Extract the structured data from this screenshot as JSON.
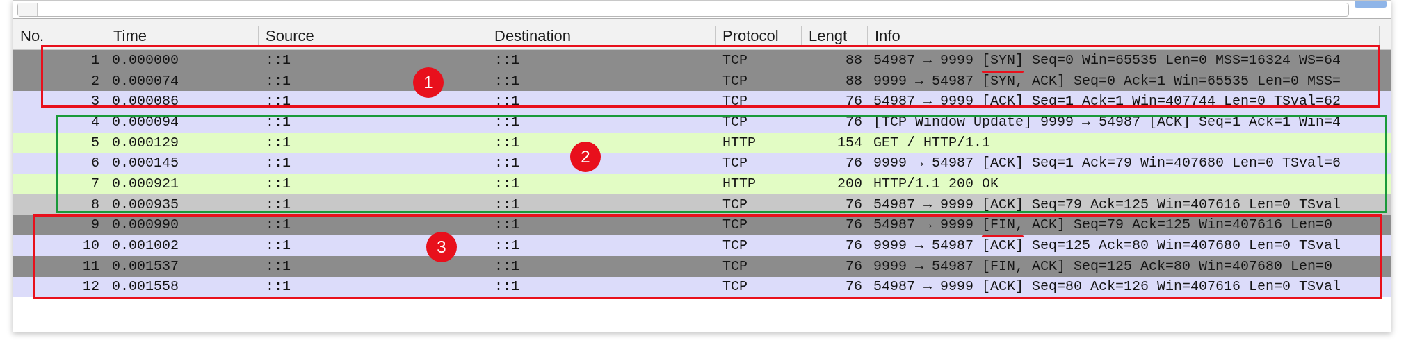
{
  "table": {
    "columns": [
      "No.",
      "Time",
      "Source",
      "Destination",
      "Protocol",
      "Lengt",
      "Info"
    ],
    "rows": [
      {
        "no": "1",
        "time": "0.000000",
        "source": "::1",
        "destination": "::1",
        "protocol": "TCP",
        "length": "88",
        "info": "54987 → 9999 [SYN] Seq=0 Win=65535 Len=0 MSS=16324 WS=64",
        "color": "#8c8c8c",
        "underlined": true
      },
      {
        "no": "2",
        "time": "0.000074",
        "source": "::1",
        "destination": "::1",
        "protocol": "TCP",
        "length": "88",
        "info": "9999 → 54987 [SYN, ACK] Seq=0 Ack=1 Win=65535 Len=0 MSS=",
        "color": "#8c8c8c",
        "underlined": false
      },
      {
        "no": "3",
        "time": "0.000086",
        "source": "::1",
        "destination": "::1",
        "protocol": "TCP",
        "length": "76",
        "info": "54987 → 9999 [ACK] Seq=1 Ack=1 Win=407744 Len=0 TSval=62",
        "color": "#dcdcfa",
        "underlined": false
      },
      {
        "no": "4",
        "time": "0.000094",
        "source": "::1",
        "destination": "::1",
        "protocol": "TCP",
        "length": "76",
        "info": "[TCP Window Update] 9999 → 54987 [ACK] Seq=1 Ack=1 Win=4",
        "color": "#dcdcfa",
        "underlined": false
      },
      {
        "no": "5",
        "time": "0.000129",
        "source": "::1",
        "destination": "::1",
        "protocol": "HTTP",
        "length": "154",
        "info": "GET / HTTP/1.1",
        "color": "#e2fcc4",
        "underlined": false
      },
      {
        "no": "6",
        "time": "0.000145",
        "source": "::1",
        "destination": "::1",
        "protocol": "TCP",
        "length": "76",
        "info": "9999 → 54987 [ACK] Seq=1 Ack=79 Win=407680 Len=0 TSval=6",
        "color": "#dcdcfa",
        "underlined": false
      },
      {
        "no": "7",
        "time": "0.000921",
        "source": "::1",
        "destination": "::1",
        "protocol": "HTTP",
        "length": "200",
        "info": "HTTP/1.1 200 OK",
        "color": "#e2fcc4",
        "underlined": false
      },
      {
        "no": "8",
        "time": "0.000935",
        "source": "::1",
        "destination": "::1",
        "protocol": "TCP",
        "length": "76",
        "info": "54987 → 9999 [ACK] Seq=79 Ack=125 Win=407616 Len=0 TSval",
        "color": "#c8c8c8",
        "underlined": false
      },
      {
        "no": "9",
        "time": "0.000990",
        "source": "::1",
        "destination": "::1",
        "protocol": "TCP",
        "length": "76",
        "info": "54987 → 9999 [FIN, ACK] Seq=79 Ack=125 Win=407616 Len=0",
        "color": "#8c8c8c",
        "underlined": true
      },
      {
        "no": "10",
        "time": "0.001002",
        "source": "::1",
        "destination": "::1",
        "protocol": "TCP",
        "length": "76",
        "info": "9999 → 54987 [ACK] Seq=125 Ack=80 Win=407680 Len=0 TSval",
        "color": "#dcdcfa",
        "underlined": false
      },
      {
        "no": "11",
        "time": "0.001537",
        "source": "::1",
        "destination": "::1",
        "protocol": "TCP",
        "length": "76",
        "info": "9999 → 54987 [FIN, ACK] Seq=125 Ack=80 Win=407680 Len=0",
        "color": "#8c8c8c",
        "underlined": false
      },
      {
        "no": "12",
        "time": "0.001558",
        "source": "::1",
        "destination": "::1",
        "protocol": "TCP",
        "length": "76",
        "info": "54987 → 9999 [ACK] Seq=80 Ack=126 Win=407616 Len=0 TSval",
        "color": "#dcdcfa",
        "underlined": false
      }
    ]
  },
  "annotations": [
    {
      "label": "1",
      "color": "#e8101c"
    },
    {
      "label": "2",
      "color": "#1a9a3a"
    },
    {
      "label": "3",
      "color": "#e8101c"
    }
  ]
}
